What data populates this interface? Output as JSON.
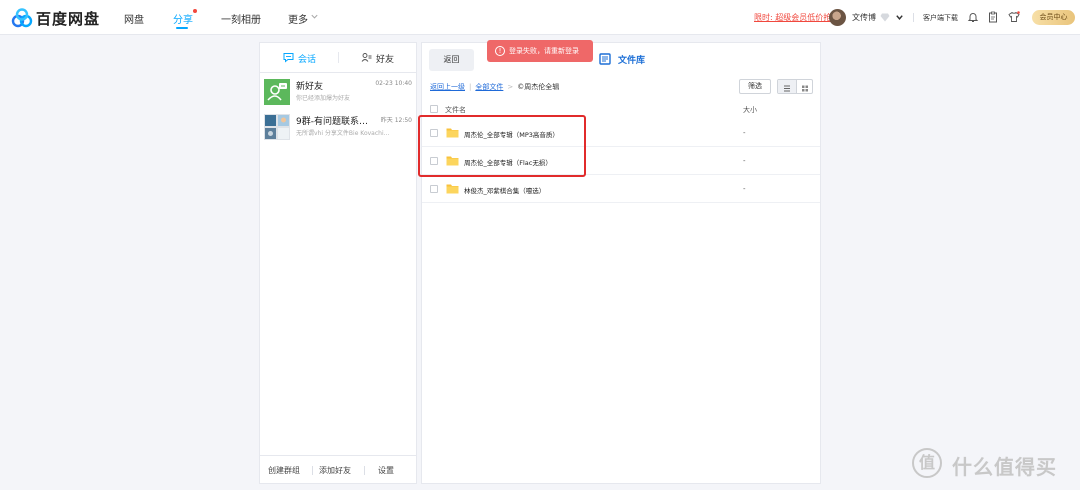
{
  "header": {
    "brand": "百度网盘",
    "nav": [
      {
        "label": "网盘"
      },
      {
        "label": "分享"
      },
      {
        "label": "一刻相册"
      },
      {
        "label": "更多"
      }
    ],
    "promo": "限时: 超级会员低价抢",
    "username": "文传博",
    "client_download": "客户端下载",
    "member_center": "会员中心"
  },
  "sidebar": {
    "tabs": [
      {
        "label": "会话"
      },
      {
        "label": "好友"
      }
    ],
    "chats": [
      {
        "name": "新好友",
        "time": "02-23 10:40",
        "message": "你已经添加爆为好友"
      },
      {
        "name": "9群-有问题联系…",
        "time": "昨天 12:50",
        "message": "无所谓vhi 分享文件Bie Kovachi…"
      }
    ],
    "footer": {
      "create_group": "创建群组",
      "add_friend": "添加好友",
      "settings": "设置"
    }
  },
  "main": {
    "back_label": "返回",
    "library_title": "文件库",
    "breadcrumb": {
      "back_one": "返回上一级",
      "all_files": "全部文件",
      "current": "©周杰伦全辑"
    },
    "filter_label": "筛选",
    "columns": {
      "name": "文件名",
      "size": "大小"
    },
    "files": [
      {
        "name": "周杰伦_全部专辑（MP3高音质）",
        "size": "-"
      },
      {
        "name": "周杰伦_全部专辑（Flac无损）",
        "size": "-"
      },
      {
        "name": "林俊杰_邓紫棋合集（嚏选）",
        "size": "-"
      }
    ]
  },
  "toast": {
    "message": "登录失败，请重新登录",
    "icon": "!"
  },
  "watermark": {
    "icon_text": "值",
    "text": "什么值得买"
  },
  "colors": {
    "accent": "#06a7ff",
    "highlight": "#e12b2b",
    "toast": "#ef6868",
    "folder": "#f9c23c"
  }
}
